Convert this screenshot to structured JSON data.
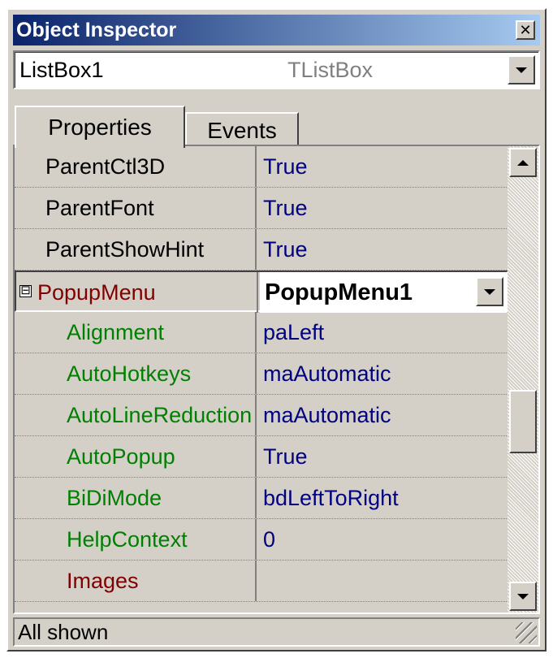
{
  "window": {
    "title": "Object Inspector",
    "close_icon": "close-icon"
  },
  "selector": {
    "object_name": "ListBox1",
    "object_type": "TListBox"
  },
  "tabs": [
    {
      "label": "Properties",
      "active": true
    },
    {
      "label": "Events",
      "active": false
    }
  ],
  "properties": [
    {
      "name": "ParentCtl3D",
      "value": "True"
    },
    {
      "name": "ParentFont",
      "value": "True"
    },
    {
      "name": "ParentShowHint",
      "value": "True"
    },
    {
      "name": "PopupMenu",
      "value": "PopupMenu1"
    },
    {
      "name": "Alignment",
      "value": "paLeft"
    },
    {
      "name": "AutoHotkeys",
      "value": "maAutomatic"
    },
    {
      "name": "AutoLineReduction",
      "value": "maAutomatic"
    },
    {
      "name": "AutoPopup",
      "value": "True"
    },
    {
      "name": "BiDiMode",
      "value": "bdLeftToRight"
    },
    {
      "name": "HelpContext",
      "value": "0"
    },
    {
      "name": "Images",
      "value": ""
    }
  ],
  "expand_glyph": "⊟",
  "status": {
    "text": "All shown"
  },
  "colors": {
    "title_gradient_start": "#0a246a",
    "title_gradient_end": "#a6caf0",
    "value_text": "#000080",
    "subproperty_text": "#008000",
    "reference_text": "#800000",
    "face": "#d4d0c8"
  }
}
